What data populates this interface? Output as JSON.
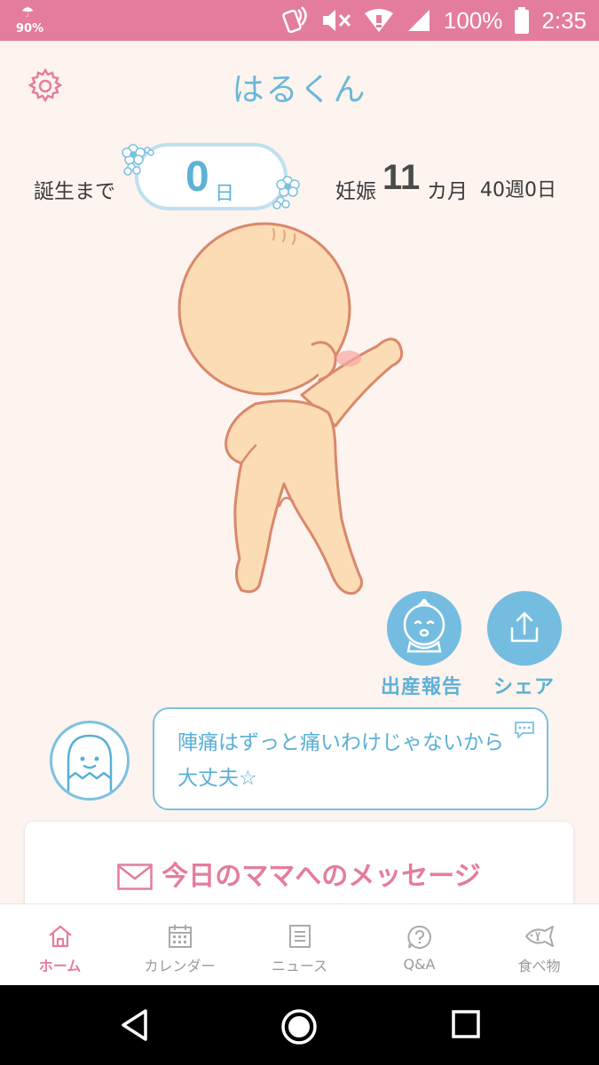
{
  "status_bar": {
    "rain_chance": "90%",
    "battery": "100%",
    "time": "2:35"
  },
  "header": {
    "title": "はるくん"
  },
  "pregnancy": {
    "until_birth_label": "誕生まで",
    "days_value": "0",
    "days_unit": "日",
    "pregnancy_label": "妊娠",
    "month_value": "11",
    "month_unit": "カ月",
    "week_day": "40週0日"
  },
  "actions": {
    "birth_report_label": "出産報告",
    "share_label": "シェア"
  },
  "advice": {
    "text": "陣痛はずっと痛いわけじゃないから大丈夫☆"
  },
  "message_card": {
    "title": "今日のママへのメッセージ"
  },
  "bottom_nav": {
    "items": [
      {
        "label": "ホーム",
        "icon": "home-icon",
        "active": true
      },
      {
        "label": "カレンダー",
        "icon": "calendar-icon",
        "active": false
      },
      {
        "label": "ニュース",
        "icon": "news-icon",
        "active": false
      },
      {
        "label": "Q&A",
        "icon": "question-icon",
        "active": false
      },
      {
        "label": "食べ物",
        "icon": "fish-icon",
        "active": false
      }
    ]
  },
  "colors": {
    "status_bar": "#e47d9b",
    "accent_blue": "#74bde0",
    "accent_pink": "#e47d9b",
    "background": "#fdf3ef"
  }
}
